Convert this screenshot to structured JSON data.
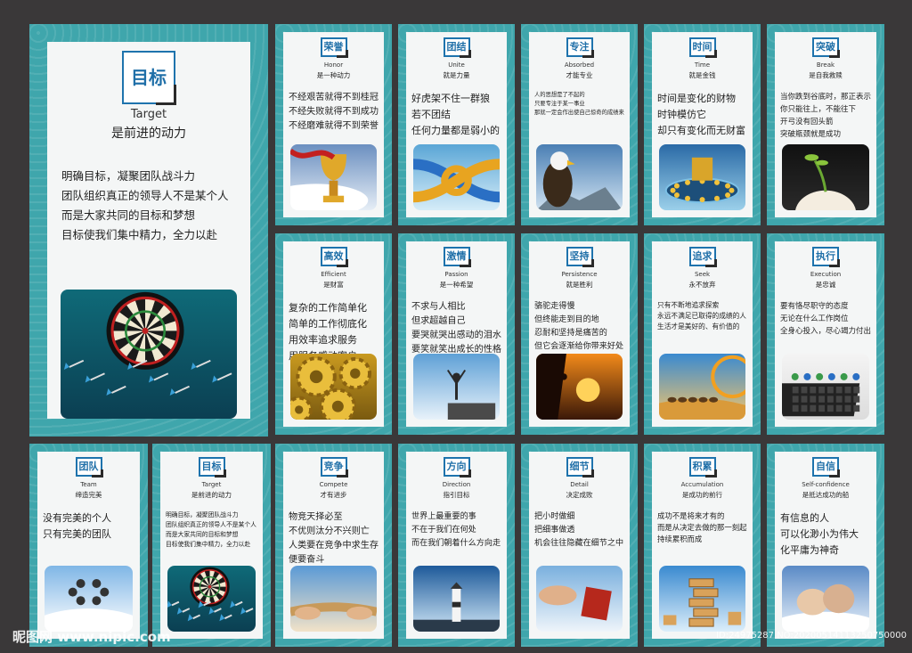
{
  "big": {
    "title": "目标",
    "en": "Target",
    "sub": "是前进的动力",
    "body": "明确目标，凝聚团队战斗力\n团队组织真正的领导人不是某个人\n而是大家共同的目标和梦想\n目标使我们集中精力，全力以赴",
    "image": "dartboard-image"
  },
  "cards": [
    {
      "title": "荣誉",
      "en": "Honor",
      "sub": "是一种动力",
      "body": "不经艰苦就得不到桂冠\n不经失败就得不到成功\n不经磨难就得不到荣誉",
      "image": "trophy-image"
    },
    {
      "title": "团结",
      "en": "Unite",
      "sub": "就是力量",
      "body": "好虎架不住一群狼\n若不团结\n任何力量都是弱小的",
      "image": "rope-knot-image"
    },
    {
      "title": "专注",
      "en": "Absorbed",
      "sub": "才能专业",
      "body": "人的思想是了不起的\n只要专注于某一事业\n那就一定会作出使自己惊奇的成绩来",
      "image": "eagle-image"
    },
    {
      "title": "时间",
      "en": "Time",
      "sub": "就是金钱",
      "body": "时间是变化的财物\n时钟模仿它\n却只有变化而无财富",
      "image": "gold-clock-image"
    },
    {
      "title": "突破",
      "en": "Break",
      "sub": "是自我救赎",
      "body": "当你跌到谷底时，那正表示\n你只能往上，不能往下\n开弓没有回头箭\n突破瓶颈就是成功",
      "image": "sprout-egg-image"
    },
    {
      "title": "高效",
      "en": "Efficient",
      "sub": "是财富",
      "body": "复杂的工作简单化\n简单的工作彻底化\n用效率追求服务\n用服务感动客户",
      "image": "gears-image"
    },
    {
      "title": "激情",
      "en": "Passion",
      "sub": "是一种希望",
      "body": "不求与人相比\n但求超越自己\n要哭就哭出感动的泪水\n要笑就笑出成长的性格",
      "image": "cheering-man-image"
    },
    {
      "title": "坚持",
      "en": "Persistence",
      "sub": "就是胜利",
      "body": "骆驼走得慢\n但终能走到目的地\n忍耐和坚持是痛苦的\n但它会逐渐给你带来好处",
      "image": "climber-sunset-image"
    },
    {
      "title": "追求",
      "en": "Seek",
      "sub": "永不放弃",
      "body": "只有不断地追求探索\n永远不满足已取得的成绩的人\n生活才是美好的、有价值的",
      "image": "camels-desert-image"
    },
    {
      "title": "执行",
      "en": "Execution",
      "sub": "是忠诚",
      "body": "要有恪尽职守的态度\n无论在什么工作岗位\n全身心投入，尽心竭力付出",
      "image": "keyboard-workers-image"
    },
    {
      "title": "团队",
      "en": "Team",
      "sub": "缔造完美",
      "body": "没有完美的个人\n只有完美的团队",
      "image": "skydivers-image"
    },
    {
      "title": "目标",
      "en": "Target",
      "sub": "是前进的动力",
      "body": "明确目标，凝聚团队战斗力\n团队组织真正的领导人不是某个人\n而是大家共同的目标和梦想\n目标使我们集中精力，全力以赴",
      "image": "dartboard-image"
    },
    {
      "title": "竞争",
      "en": "Compete",
      "sub": "才有进步",
      "body": "物竞天择必至\n不优则汰分不兴则亡\n人类要在竞争中求生存\n便要奋斗",
      "image": "tug-of-war-image"
    },
    {
      "title": "方向",
      "en": "Direction",
      "sub": "指引目标",
      "body": "世界上最重要的事\n不在于我们在何处\n而在我们朝着什么方向走",
      "image": "lighthouse-image"
    },
    {
      "title": "细节",
      "en": "Detail",
      "sub": "决定成败",
      "body": "把小时做细\n把细事做透\n机会往往隐藏在细节之中",
      "image": "cube-hand-image"
    },
    {
      "title": "积累",
      "en": "Accumulation",
      "sub": "是成功的前行",
      "body": "成功不是将来才有的\n而是从决定去做的那一刻起\n持续累积而成",
      "image": "wood-blocks-image"
    },
    {
      "title": "自信",
      "en": "Self-confidence",
      "sub": "是抵达成功的船",
      "body": "有信息的人\n可以化渺小为伟大\n化平庸为神奇",
      "image": "fist-image"
    }
  ],
  "watermark": {
    "site": "昵图网 www.nipic.com",
    "ids": "ID:24975287 NO:20200514113250750000"
  }
}
